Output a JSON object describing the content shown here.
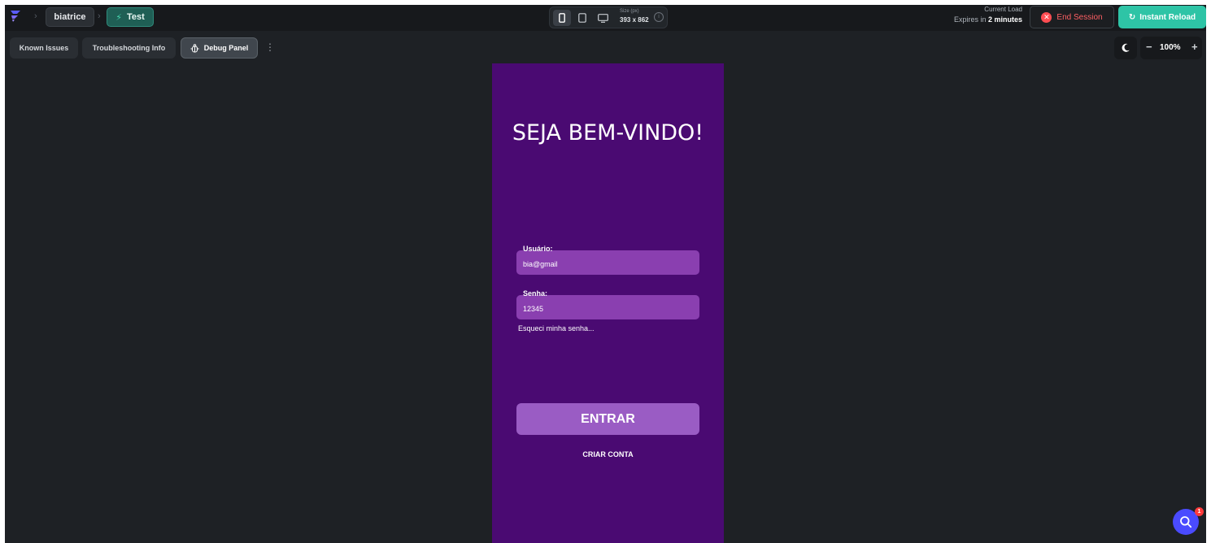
{
  "topbar": {
    "project_name": "biatrice",
    "mode_label": "Test",
    "device_size_label": "Size (px)",
    "device_size_value": "393 x 862",
    "current_load_label": "Current Load",
    "expires_prefix": "Expires in ",
    "expires_value": "2 minutes",
    "end_session_label": "End Session",
    "instant_reload_label": "Instant Reload"
  },
  "toolbar": {
    "tabs": [
      {
        "label": "Known Issues"
      },
      {
        "label": "Troubleshooting Info"
      },
      {
        "label": "Debug Panel"
      }
    ],
    "zoom": "100%"
  },
  "app_preview": {
    "title": "SEJA BEM-VINDO!",
    "user_label": "Usuário:",
    "user_value": "bia@gmail",
    "password_label": "Senha:",
    "password_value": "12345",
    "forgot_link": "Esqueci minha senha...",
    "enter_button": "ENTRAR",
    "create_account": "CRIAR CONTA",
    "background_color": "#4a0a72"
  },
  "notification_badge": "1",
  "icons": [
    "logo-icon",
    "bolt-icon",
    "phone-icon",
    "tablet-icon",
    "desktop-icon",
    "info-icon",
    "close-circle-icon",
    "reload-icon",
    "debug-icon",
    "kebab-icon",
    "moon-icon",
    "search-icon"
  ],
  "colors": {
    "accent": "#2ec4a6",
    "danger": "#ff5f63",
    "brand_purple": "#4a0a72",
    "field_purple": "#8a3fb0"
  }
}
